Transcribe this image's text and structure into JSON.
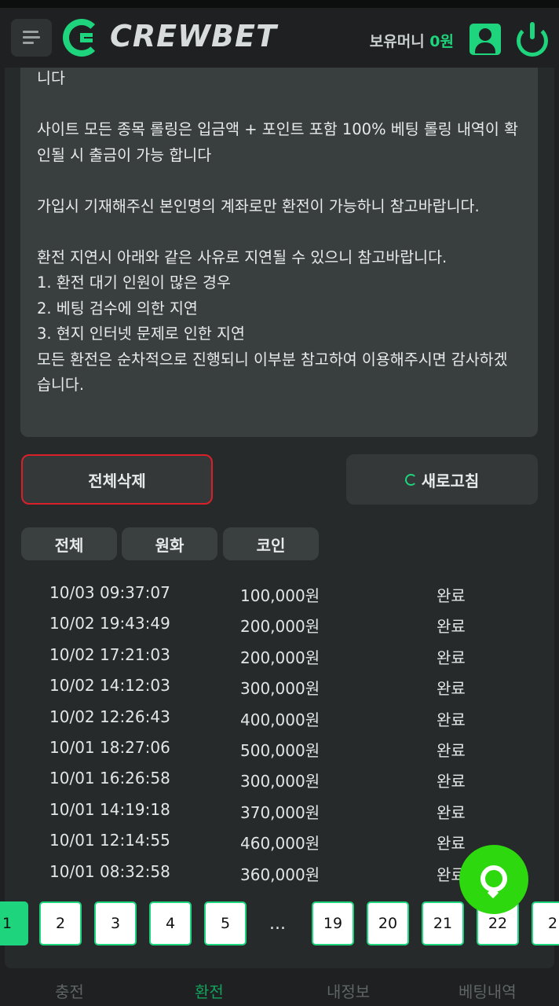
{
  "header": {
    "logo_text": "CREWBET",
    "money_label": "보유머니",
    "money_value": "0원"
  },
  "notice": {
    "text": "니다\n\n사이트 모든 종목 롤링은 입금액 + 포인트 포함 100% 베팅 롤링 내역이 확인될 시 출금이 가능 합니다\n\n가입시 기재해주신 본인명의 계좌로만 환전이 가능하니 참고바랍니다.\n\n환전 지연시 아래와 같은 사유로 지연될 수 있으니 참고바랍니다.\n1. 환전 대기 인원이 많은 경우\n2. 베팅 검수에 의한 지연\n3. 현지 인터넷 문제로 인한 지연\n모든 환전은 순차적으로 진행되니 이부분 참고하여 이용해주시면 감사하겠습니다."
  },
  "actions": {
    "delete_all": "전체삭제",
    "refresh": "새로고침"
  },
  "filters": [
    "전체",
    "원화",
    "코인"
  ],
  "records": [
    {
      "date": "10/03 09:37:07",
      "amount": "100,000원",
      "status": "완료"
    },
    {
      "date": "10/02 19:43:49",
      "amount": "200,000원",
      "status": "완료"
    },
    {
      "date": "10/02 17:21:03",
      "amount": "200,000원",
      "status": "완료"
    },
    {
      "date": "10/02 14:12:03",
      "amount": "300,000원",
      "status": "완료"
    },
    {
      "date": "10/02 12:26:43",
      "amount": "400,000원",
      "status": "완료"
    },
    {
      "date": "10/01 18:27:06",
      "amount": "500,000원",
      "status": "완료"
    },
    {
      "date": "10/01 16:26:58",
      "amount": "300,000원",
      "status": "완료"
    },
    {
      "date": "10/01 14:19:18",
      "amount": "370,000원",
      "status": "완료"
    },
    {
      "date": "10/01 12:14:55",
      "amount": "460,000원",
      "status": "완료"
    },
    {
      "date": "10/01 08:32:58",
      "amount": "360,000원",
      "status": "완료"
    }
  ],
  "pager": {
    "pages": [
      "1",
      "2",
      "3",
      "4",
      "5",
      "19",
      "20",
      "21",
      "22",
      "2"
    ],
    "ellipsis": "...",
    "current": "1"
  },
  "bottom_nav": [
    "충전",
    "환전",
    "내정보",
    "베팅내역"
  ],
  "colors": {
    "accent": "#1ed47c",
    "danger": "#d9202a",
    "chat": "#2dd80e"
  },
  "icons": [
    "menu-icon",
    "user-icon",
    "power-icon",
    "refresh-icon",
    "chat-icon"
  ]
}
